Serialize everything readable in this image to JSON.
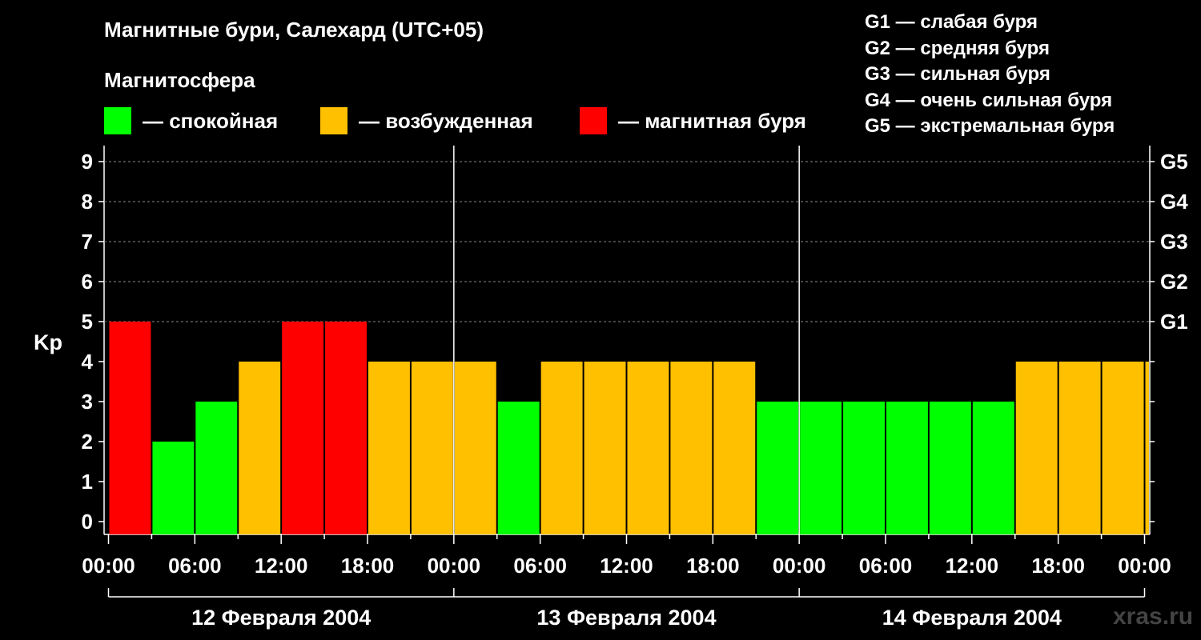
{
  "title": "Магнитные бури, Салехард (UTC+05)",
  "subtitle": "Магнитосфера",
  "legend": [
    {
      "label": "— спокойная",
      "color": "#00ff00"
    },
    {
      "label": "— возбужденная",
      "color": "#ffc000"
    },
    {
      "label": "— магнитная буря",
      "color": "#ff0000"
    }
  ],
  "g_scale": [
    "G1 — слабая буря",
    "G2 — средняя буря",
    "G3 — сильная буря",
    "G4 — очень сильная буря",
    "G5 — экстремальная буря"
  ],
  "credit": "xras.ru",
  "chart_data": {
    "type": "bar",
    "ylabel": "Kp",
    "ylim": [
      0,
      9
    ],
    "yticks": [
      "0",
      "1",
      "2",
      "3",
      "4",
      "5",
      "6",
      "7",
      "8",
      "9"
    ],
    "right_labels": [
      {
        "value": 5,
        "label": "G1"
      },
      {
        "value": 6,
        "label": "G2"
      },
      {
        "value": 7,
        "label": "G3"
      },
      {
        "value": 8,
        "label": "G4"
      },
      {
        "value": 9,
        "label": "G5"
      }
    ],
    "xticks": [
      "00:00",
      "06:00",
      "12:00",
      "18:00",
      "00:00",
      "06:00",
      "12:00",
      "18:00",
      "00:00",
      "06:00",
      "12:00",
      "18:00",
      "00:00"
    ],
    "days": [
      "12 Февраля 2004",
      "13 Февраля 2004",
      "14 Февраля 2004"
    ],
    "values": [
      5,
      2,
      3,
      4,
      5,
      5,
      4,
      4,
      4,
      3,
      4,
      4,
      4,
      4,
      4,
      3,
      3,
      3,
      3,
      3,
      3,
      4,
      4,
      4,
      4
    ],
    "levels": [
      "storm",
      "quiet",
      "quiet",
      "active",
      "storm",
      "storm",
      "active",
      "active",
      "active",
      "quiet",
      "active",
      "active",
      "active",
      "active",
      "active",
      "quiet",
      "quiet",
      "quiet",
      "quiet",
      "quiet",
      "quiet",
      "active",
      "active",
      "active",
      "active"
    ],
    "colors": {
      "quiet": "#00ff00",
      "active": "#ffc000",
      "storm": "#ff0000"
    },
    "grid": true
  }
}
